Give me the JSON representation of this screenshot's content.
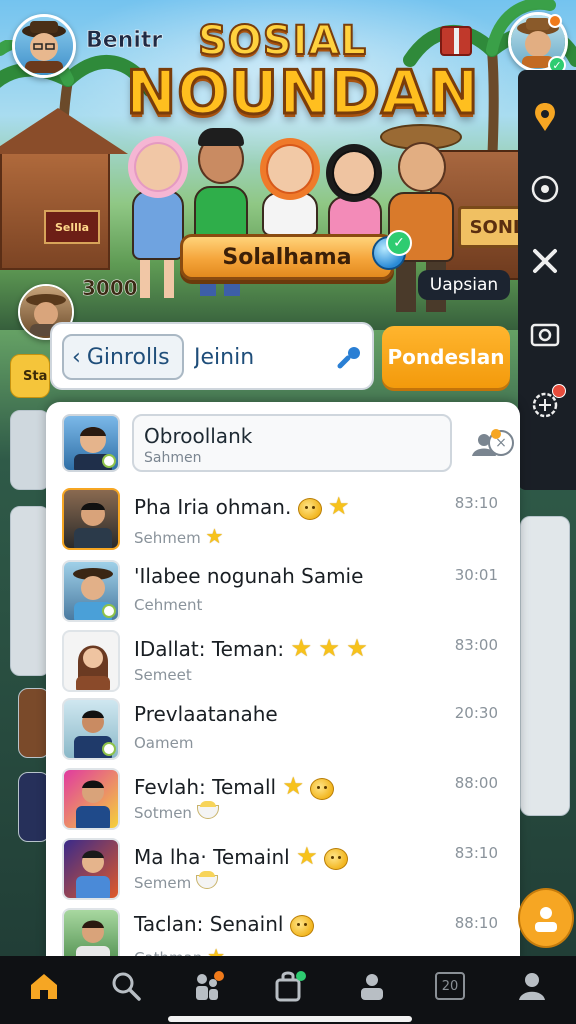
{
  "header": {
    "username": "Benitr",
    "title_top": "SOSIAL",
    "title_main": "NOUNDAN",
    "cta_label": "Solalhama",
    "coins": "3000",
    "tag": "Uapsian",
    "house_sign_left": "Sellla",
    "house_sign_right": "SONL"
  },
  "search": {
    "back_label": "Ginrolls",
    "input_placeholder": "Jeinin",
    "action_label": "Pondeslan"
  },
  "top_entry": {
    "title": "Obroollank",
    "subtitle": "Sahmen",
    "clear_icon": "×"
  },
  "rows": [
    {
      "title": "Pha Iria ohman.",
      "subtitle": "Sehmem",
      "time": "83:10"
    },
    {
      "title": "'Ilabee nogunah Samie",
      "subtitle": "Cehment",
      "time": "30:01"
    },
    {
      "title": "IDallat: Teman:",
      "subtitle": "Semeet",
      "time": "83:00"
    },
    {
      "title": "Prevlaatanahe",
      "subtitle": "Oamem",
      "time": "20:30"
    },
    {
      "title": "Fevlah: Temall",
      "subtitle": "Sotmen",
      "time": "88:00"
    },
    {
      "title": "Ma lha· Temainl",
      "subtitle": "Semem",
      "time": "83:10"
    },
    {
      "title": "Taclan: Senainl",
      "subtitle": "Cathman",
      "time": "88:10"
    }
  ],
  "side_left_label": "Sta",
  "bottom_nav": {
    "calendar_label": "20"
  },
  "colors": {
    "accent_orange": "#f39a0c",
    "title_gold": "#ffbf1f",
    "nav_active": "#f6a623",
    "panel_bg": "#ffffff"
  }
}
